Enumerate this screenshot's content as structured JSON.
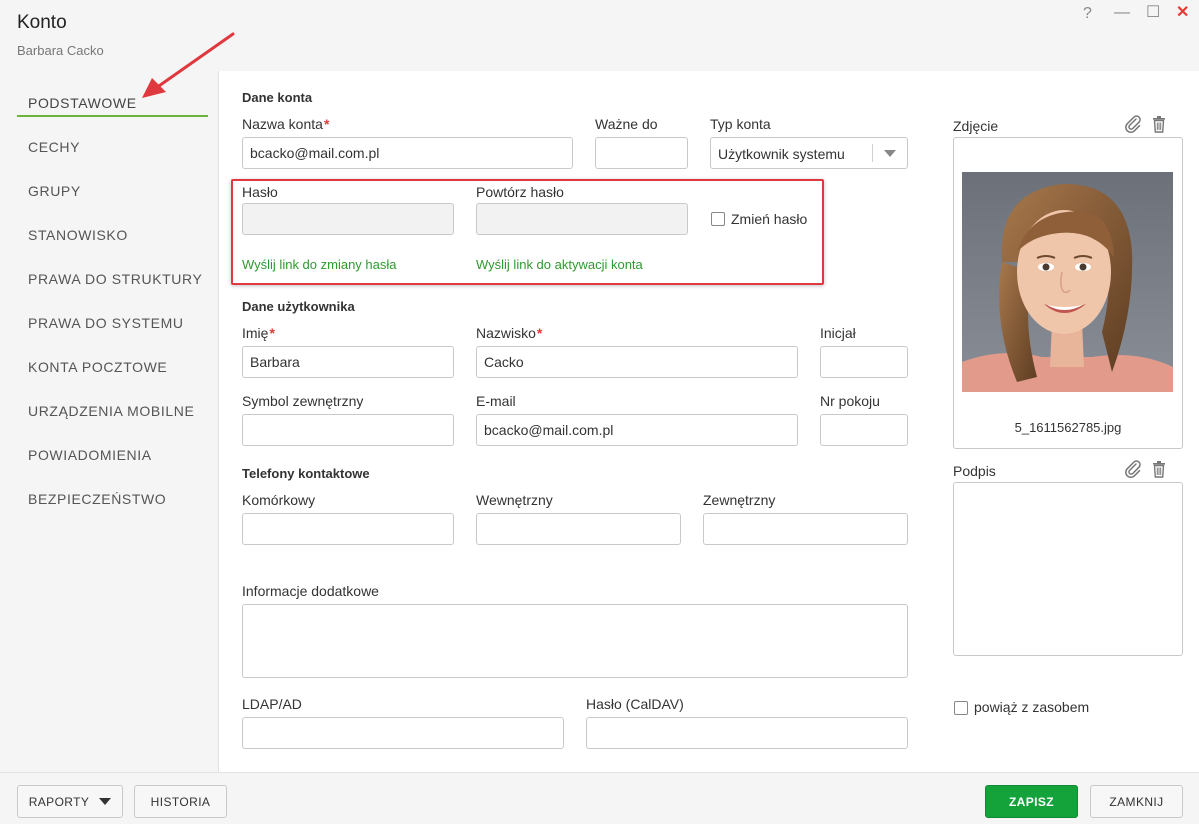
{
  "window": {
    "title": "Konto",
    "subtitle": "Barbara Cacko",
    "help": "?",
    "minimize": "—",
    "maximize": "☐",
    "close": "✕"
  },
  "sidebar": {
    "items": [
      {
        "label": "PODSTAWOWE",
        "active": true
      },
      {
        "label": "CECHY"
      },
      {
        "label": "GRUPY"
      },
      {
        "label": "STANOWISKO"
      },
      {
        "label": "PRAWA DO STRUKTURY"
      },
      {
        "label": "PRAWA DO SYSTEMU"
      },
      {
        "label": "KONTA POCZTOWE"
      },
      {
        "label": "URZĄDZENIA MOBILNE"
      },
      {
        "label": "POWIADOMIENIA"
      },
      {
        "label": "BEZPIECZEŃSTWO"
      }
    ]
  },
  "account": {
    "section": "Dane konta",
    "name_label": "Nazwa konta",
    "name_value": "bcacko@mail.com.pl",
    "valid_label": "Ważne do",
    "valid_value": "",
    "type_label": "Typ konta",
    "type_value": "Użytkownik systemu",
    "password_label": "Hasło",
    "repeat_password_label": "Powtórz hasło",
    "change_password_label": "Zmień hasło",
    "change_password_checked": false,
    "reset_link": "Wyślij link do zmiany hasła",
    "activation_link": "Wyślij link do aktywacji konta"
  },
  "user": {
    "section": "Dane użytkownika",
    "first_name_label": "Imię",
    "first_name_value": "Barbara",
    "last_name_label": "Nazwisko",
    "last_name_value": "Cacko",
    "initial_label": "Inicjał",
    "initial_value": "",
    "external_symbol_label": "Symbol zewnętrzny",
    "external_symbol_value": "",
    "email_label": "E-mail",
    "email_value": "bcacko@mail.com.pl",
    "room_label": "Nr pokoju",
    "room_value": ""
  },
  "phones": {
    "section": "Telefony kontaktowe",
    "mobile_label": "Komórkowy",
    "internal_label": "Wewnętrzny",
    "external_label": "Zewnętrzny"
  },
  "extra": {
    "info_label": "Informacje dodatkowe",
    "ldap_label": "LDAP/AD",
    "caldav_label": "Hasło (CalDAV)"
  },
  "photo": {
    "label": "Zdjęcie",
    "filename": "5_1611562785.jpg"
  },
  "signature": {
    "label": "Podpis"
  },
  "resource": {
    "label": "powiąż z zasobem",
    "checked": false
  },
  "footer": {
    "reports": "RAPORTY",
    "history": "HISTORIA",
    "save": "ZAPISZ",
    "close": "ZAMKNIJ"
  },
  "colors": {
    "accent_green": "#6db33f",
    "link_green": "#2f9a2f",
    "save_button": "#14a33b",
    "highlight_red": "#e0383f",
    "close_red": "#e53935"
  },
  "icons": {
    "attach": "paperclip-icon",
    "delete": "trash-icon",
    "dropdown": "chevron-down-icon"
  }
}
